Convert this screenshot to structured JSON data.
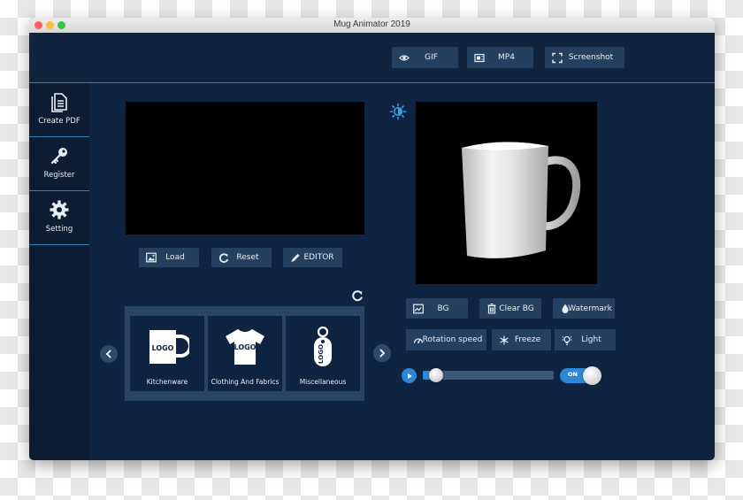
{
  "window": {
    "title": "Mug Animator 2019"
  },
  "export": {
    "gif": {
      "label": "GIF",
      "icon": "eye-icon"
    },
    "mp4": {
      "label": "MP4",
      "icon": "film-icon"
    },
    "screenshot": {
      "label": "Screenshot",
      "icon": "expand-icon"
    }
  },
  "sidebar": {
    "items": [
      {
        "label": "Create PDF",
        "icon": "document-icon"
      },
      {
        "label": "Register",
        "icon": "key-icon"
      },
      {
        "label": "Setting",
        "icon": "gear-icon"
      }
    ]
  },
  "editor": {
    "load": {
      "label": "Load",
      "icon": "image-icon"
    },
    "reset": {
      "label": "Reset",
      "icon": "reset-icon"
    },
    "editor": {
      "label": "EDITOR",
      "icon": "pencil-icon"
    }
  },
  "categories": {
    "items": [
      {
        "label": "Kitchenware",
        "icon": "mug-logo-icon",
        "logo": "LOGO"
      },
      {
        "label": "Clothing And Fabrics",
        "icon": "tshirt-logo-icon",
        "logo": "LOGO"
      },
      {
        "label": "Miscellaneous",
        "icon": "keychain-logo-icon",
        "logo": "LOGO"
      }
    ]
  },
  "preview": {
    "bg": {
      "label": "BG",
      "icon": "image-icon"
    },
    "clear_bg": {
      "label": "Clear BG",
      "icon": "trash-icon"
    },
    "watermark": {
      "label": "Watermark",
      "icon": "drop-icon"
    },
    "rotation_speed": {
      "label": "Rotation speed",
      "icon": "gauge-icon"
    },
    "freeze": {
      "label": "Freeze",
      "icon": "snowflake-icon"
    },
    "light": {
      "label": "Light",
      "icon": "bulb-icon"
    }
  },
  "playback": {
    "toggle_label": "ON",
    "slider_fraction": 0.1
  },
  "colors": {
    "accent": "#2f86b5",
    "background": "#0f2440",
    "button": "#25405f"
  }
}
